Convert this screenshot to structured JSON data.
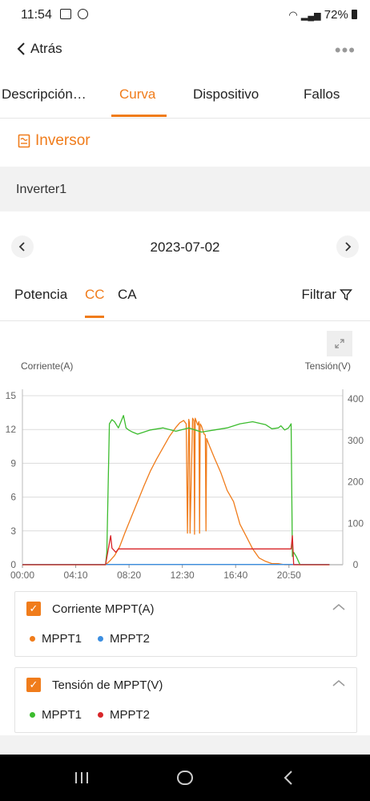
{
  "status_bar": {
    "time": "11:54",
    "battery": "72%"
  },
  "header": {
    "back_label": "Atrás"
  },
  "tabs": [
    {
      "label": "Descripción…",
      "active": false
    },
    {
      "label": "Curva",
      "active": true
    },
    {
      "label": "Dispositivo",
      "active": false
    },
    {
      "label": "Fallos",
      "active": false
    }
  ],
  "section": {
    "title": "Inversor"
  },
  "device": {
    "name": "Inverter1"
  },
  "date_nav": {
    "date": "2023-07-02"
  },
  "subtabs": [
    {
      "label": "Potencia",
      "active": false
    },
    {
      "label": "CC",
      "active": true
    },
    {
      "label": "CA",
      "active": false
    }
  ],
  "filter_label": "Filtrar",
  "colors": {
    "accent": "#f07c1b",
    "mppt1_current": "#f07c1b",
    "mppt2_current": "#3c8ee0",
    "mppt1_voltage": "#3cbc2e",
    "mppt2_voltage": "#d8262a"
  },
  "chart_data": {
    "type": "line",
    "ylabel_left": "Corriente(A)",
    "ylabel_right": "Tensión(V)",
    "x_ticks": [
      "00:00",
      "04:10",
      "08:20",
      "12:30",
      "16:40",
      "20:50"
    ],
    "y_left_ticks": [
      "0",
      "3",
      "6",
      "9",
      "12",
      "15"
    ],
    "y_right_ticks": [
      "0",
      "100",
      "200",
      "300",
      "400"
    ],
    "ylim_left": [
      0,
      15
    ],
    "ylim_right": [
      0,
      400
    ],
    "xlim_hours": [
      0,
      24
    ],
    "grid": true,
    "series": [
      {
        "name": "MPPT1",
        "group": "Corriente MPPT(A)",
        "axis": "left",
        "color": "#f07c1b",
        "x": [
          0,
          6.5,
          6.8,
          7.2,
          7.6,
          8.0,
          8.5,
          9.0,
          9.5,
          10.0,
          10.5,
          11.0,
          11.5,
          12.0,
          12.3,
          12.6,
          12.8,
          12.9,
          13.0,
          13.05,
          13.1,
          13.3,
          13.4,
          13.45,
          13.5,
          13.7,
          13.8,
          13.85,
          13.9,
          14.0,
          14.2,
          14.3,
          14.35,
          14.4,
          14.6,
          15.0,
          15.5,
          16.0,
          16.5,
          17.0,
          17.5,
          18.0,
          18.5,
          19.0,
          19.5,
          20.0,
          20.5,
          21.0,
          21.3,
          24.0
        ],
        "y": [
          0,
          0,
          0.3,
          0.8,
          1.6,
          2.8,
          4.2,
          5.6,
          7.0,
          8.3,
          9.4,
          10.4,
          11.4,
          12.2,
          12.6,
          12.8,
          12.5,
          2.8,
          12.9,
          12.6,
          2.8,
          13.0,
          12.8,
          2.7,
          13.0,
          12.4,
          12.7,
          2.8,
          12.5,
          12.3,
          11.6,
          11.5,
          3.0,
          11.2,
          10.6,
          9.5,
          8.2,
          6.6,
          5.6,
          3.6,
          2.5,
          1.4,
          0.6,
          0.3,
          0.1,
          0.1,
          0.0,
          0.0,
          0.0,
          0
        ]
      },
      {
        "name": "MPPT2",
        "group": "Corriente MPPT(A)",
        "axis": "left",
        "color": "#3c8ee0",
        "x": [
          0,
          24
        ],
        "y": [
          0.02,
          0.02
        ]
      },
      {
        "name": "MPPT1",
        "group": "Tensión de MPPT(V)",
        "axis": "right",
        "color": "#3cbc2e",
        "x": [
          0,
          6.5,
          6.6,
          6.8,
          7.0,
          7.2,
          7.5,
          7.7,
          7.9,
          8.1,
          8.3,
          8.6,
          9.0,
          10.0,
          11.0,
          12.0,
          13.0,
          14.0,
          15.0,
          16.0,
          17.0,
          18.0,
          19.0,
          19.5,
          20.0,
          20.2,
          20.5,
          20.8,
          21.0,
          21.1,
          21.2,
          21.4,
          21.7,
          24.0
        ],
        "y": [
          0,
          0,
          30,
          340,
          350,
          345,
          330,
          345,
          360,
          330,
          325,
          320,
          315,
          325,
          330,
          322,
          330,
          320,
          325,
          330,
          340,
          345,
          338,
          328,
          330,
          335,
          325,
          330,
          340,
          20,
          30,
          20,
          0,
          0
        ]
      },
      {
        "name": "MPPT2",
        "group": "Tensión de MPPT(V)",
        "axis": "right",
        "color": "#d8262a",
        "x": [
          0,
          6.5,
          6.9,
          7.0,
          7.3,
          7.5,
          8.0,
          10.0,
          12.0,
          14.0,
          16.0,
          18.0,
          20.0,
          20.5,
          20.8,
          21.0,
          21.1,
          21.2,
          24.0
        ],
        "y": [
          0,
          0,
          70,
          40,
          30,
          38,
          38,
          38,
          38,
          38,
          38,
          38,
          38,
          38,
          38,
          38,
          70,
          0,
          0
        ]
      }
    ]
  },
  "legend_groups": [
    {
      "title": "Corriente MPPT(A)",
      "items": [
        {
          "name": "MPPT1",
          "color": "#f07c1b"
        },
        {
          "name": "MPPT2",
          "color": "#3c8ee0"
        }
      ]
    },
    {
      "title": "Tensión de MPPT(V)",
      "items": [
        {
          "name": "MPPT1",
          "color": "#3cbc2e"
        },
        {
          "name": "MPPT2",
          "color": "#d8262a"
        }
      ]
    }
  ]
}
